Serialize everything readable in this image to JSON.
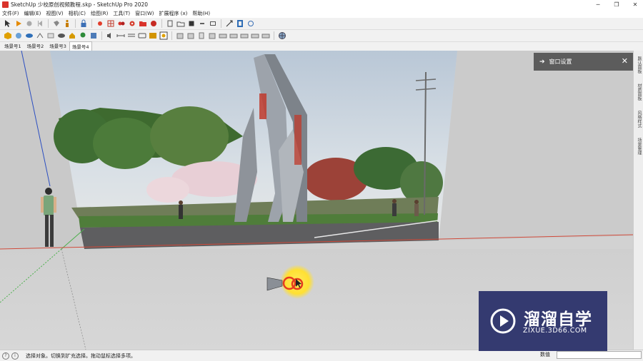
{
  "titlebar": {
    "title": "SketchUp 少校原创视频教程.skp - SketchUp Pro 2020"
  },
  "menu": [
    "文件(F)",
    "编辑(E)",
    "视图(V)",
    "相机(C)",
    "绘图(R)",
    "工具(T)",
    "窗口(W)",
    "扩展程序 (x)",
    "帮助(H)"
  ],
  "scenes": [
    "场景号1",
    "场景号2",
    "场景号3",
    "场景号4"
  ],
  "tray": {
    "title": "窗口设置"
  },
  "right_rail_tabs": [
    "默认面板",
    "材质面板",
    "风格样式",
    "场景管理"
  ],
  "status": {
    "hint": "选择对象。切换到扩充选择。拖动鼠标选择多项。",
    "measure_label": "数值",
    "measure_value": ""
  },
  "watermark": {
    "name": "溜溜自学",
    "url": "ZIXUE.3D66.COM"
  },
  "colors": {
    "accent_brand": "#d9332b",
    "tray_bg": "#5c5c5c",
    "watermark_bg": "#282e68"
  }
}
